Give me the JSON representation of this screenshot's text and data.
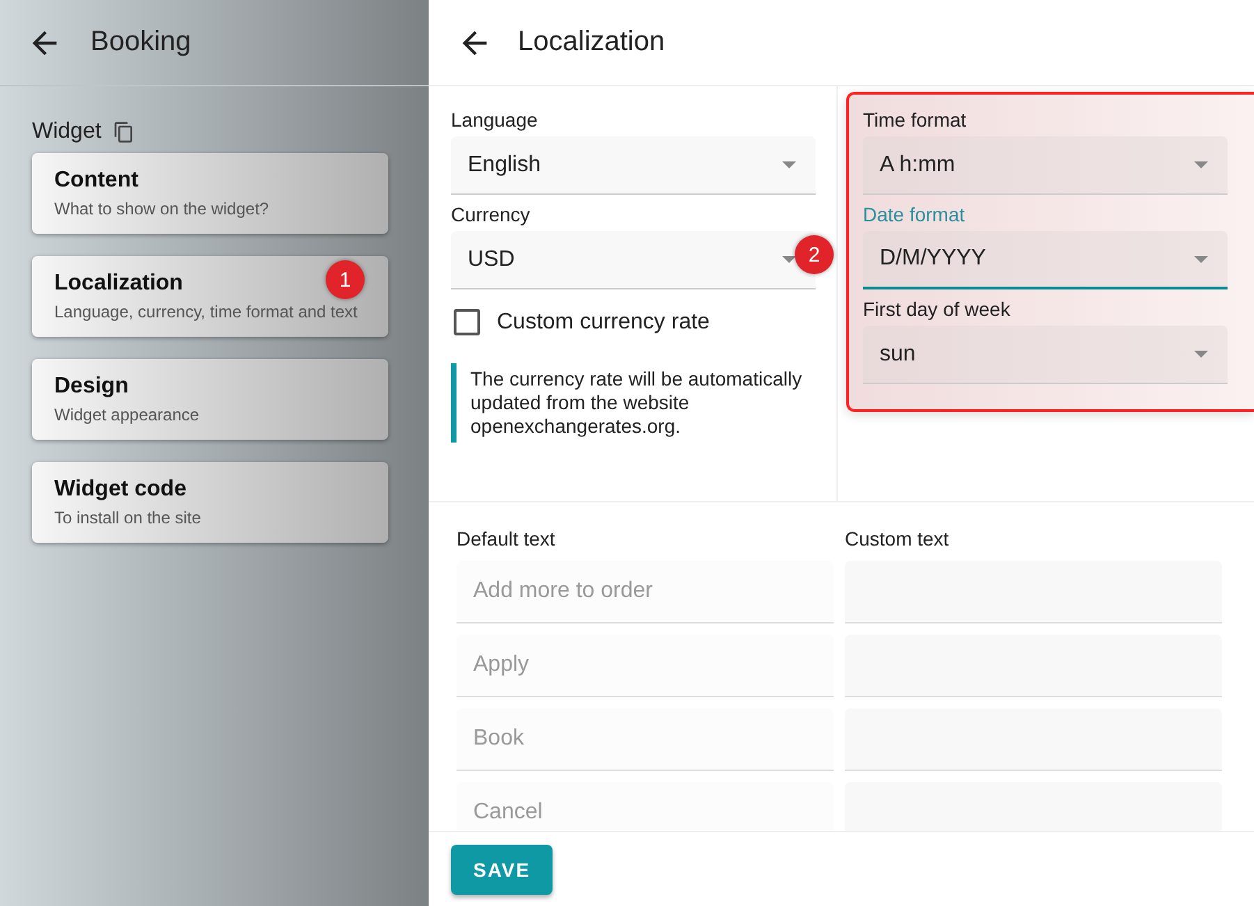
{
  "sidebar": {
    "title": "Booking",
    "section_label": "Widget",
    "items": [
      {
        "title": "Content",
        "subtitle": "What to show on the widget?"
      },
      {
        "title": "Localization",
        "subtitle": "Language, currency, time format and text",
        "badge": "1"
      },
      {
        "title": "Design",
        "subtitle": "Widget appearance"
      },
      {
        "title": "Widget code",
        "subtitle": "To install on the site"
      }
    ]
  },
  "main": {
    "title": "Localization",
    "left_fields": [
      {
        "label": "Language",
        "value": "English",
        "focused": false
      },
      {
        "label": "Currency",
        "value": "USD",
        "focused": false
      }
    ],
    "custom_rate": {
      "label": "Custom currency rate",
      "checked": false
    },
    "note": "The currency rate will be automatically updated from the website openexchangerates.org.",
    "callout_badge": "2",
    "right_fields": [
      {
        "label": "Time format",
        "value": "A h:mm",
        "focused": false
      },
      {
        "label": "Date format",
        "value": "D/M/YYYY",
        "focused": true
      },
      {
        "label": "First day of week",
        "value": "sun",
        "focused": false
      }
    ],
    "texts": {
      "default_header": "Default text",
      "custom_header": "Custom text",
      "rows": [
        {
          "default": "Add more to order"
        },
        {
          "default": "Apply"
        },
        {
          "default": "Book"
        },
        {
          "default": "Cancel"
        }
      ]
    },
    "save_button": "SAVE"
  }
}
